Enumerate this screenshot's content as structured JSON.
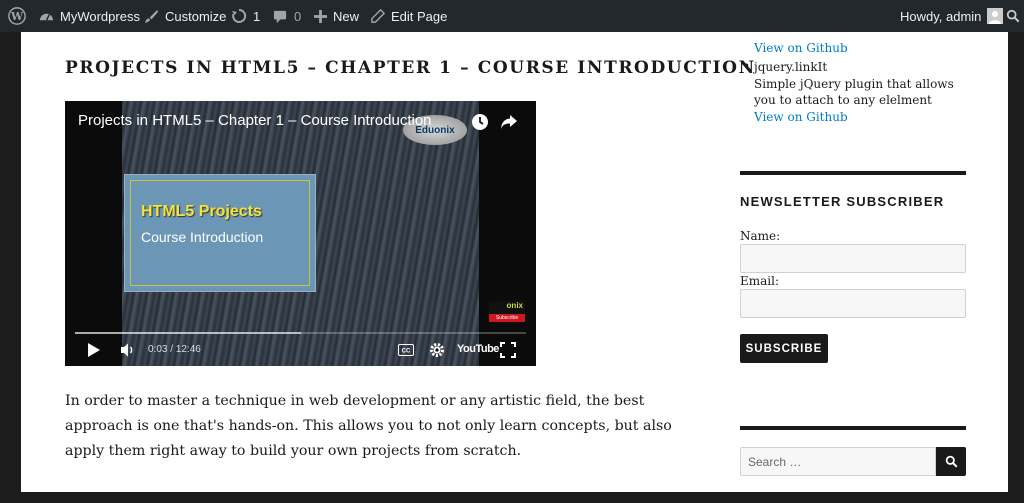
{
  "admin_bar": {
    "site_name": "MyWordpress",
    "customize": "Customize",
    "updates_count": "1",
    "comments_count": "0",
    "new": "New",
    "edit_page": "Edit Page",
    "greeting": "Howdy, admin"
  },
  "post": {
    "title": "PROJECTS IN HTML5 – CHAPTER 1 – COURSE INTRODUCTION",
    "video": {
      "title": "Projects in HTML5 – Chapter 1 – Course Introduction",
      "logo_text": "Eduonix",
      "slide_heading": "HTML5 Projects",
      "slide_subheading": "Course Introduction",
      "channel_badge": "onix",
      "channel_badge_sub": "Subscribe",
      "time": "0:03 / 12:46",
      "youtube": "YouTube",
      "played_fraction": 0.5
    },
    "body": "In order to master a technique in web development or any artistic field, the best approach is one that's hands-on. This allows you to not only learn concepts, but also apply them right away to build your own projects from scratch."
  },
  "sidebar": {
    "prev_link": "View on Github",
    "plugin_name": "jquery.linkIt",
    "plugin_desc": "Simple jQuery plugin that allows you to attach to any elelment",
    "plugin_link": "View on Github",
    "newsletter": {
      "title": "NEWSLETTER SUBSCRIBER",
      "name_label": "Name:",
      "email_label": "Email:",
      "button": "SUBSCRIBE"
    },
    "search": {
      "placeholder": "Search …"
    }
  }
}
